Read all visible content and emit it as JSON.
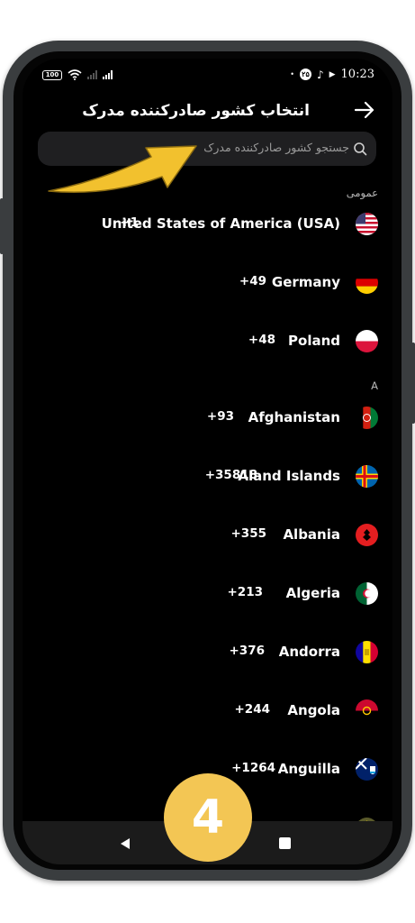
{
  "status_bar": {
    "battery": "100",
    "time": "10:23",
    "notification_badge": "۲۵",
    "icons": [
      "battery-icon",
      "wifi-icon",
      "signal-icon",
      "notification-icon",
      "music-icon",
      "play-icon"
    ]
  },
  "header": {
    "title": "انتخاب کشور صادرکننده مدرک",
    "back_icon": "arrow-right-icon"
  },
  "search": {
    "placeholder": "جستجو کشور صادرکننده مدرک",
    "icon": "search-icon"
  },
  "sections": {
    "general": "عمومی",
    "a": "A"
  },
  "countries": [
    {
      "name": "United States of America (USA)",
      "code": "+1",
      "flag": "us-flag-icon"
    },
    {
      "name": "Germany",
      "code": "+49",
      "flag": "de-flag-icon"
    },
    {
      "name": "Poland",
      "code": "+48",
      "flag": "pl-flag-icon"
    },
    {
      "name": "Afghanistan",
      "code": "+93",
      "flag": "af-flag-icon"
    },
    {
      "name": "Aland Islands",
      "code": "+35818",
      "flag": "ax-flag-icon"
    },
    {
      "name": "Albania",
      "code": "+355",
      "flag": "al-flag-icon"
    },
    {
      "name": "Algeria",
      "code": "+213",
      "flag": "dz-flag-icon"
    },
    {
      "name": "Andorra",
      "code": "+376",
      "flag": "ad-flag-icon"
    },
    {
      "name": "Angola",
      "code": "+244",
      "flag": "ao-flag-icon"
    },
    {
      "name": "Anguilla",
      "code": "+1264",
      "flag": "ai-flag-icon"
    }
  ],
  "overlay": {
    "step_number": "4",
    "arrow_color": "#f2c12e"
  },
  "colors": {
    "background": "#000000",
    "search_bg": "#1f1f21",
    "badge": "#f3c654"
  }
}
